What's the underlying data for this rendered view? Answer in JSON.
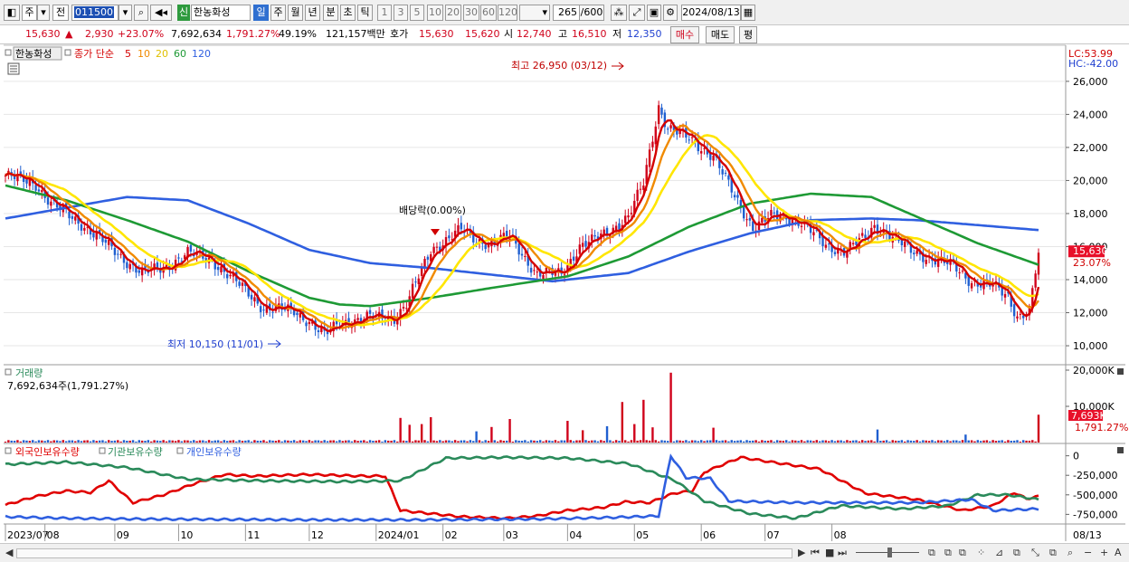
{
  "toolbar": {
    "market_labels": [
      "주",
      "전"
    ],
    "stock_code": "011500",
    "tag_new": "신",
    "stock_name": "한농화성",
    "periods": [
      "일",
      "주",
      "월",
      "년",
      "분",
      "초",
      "틱"
    ],
    "active_period": "일",
    "intervals": [
      "1",
      "3",
      "5",
      "10",
      "20",
      "30",
      "60",
      "120"
    ],
    "count": "265",
    "count_max": "/600",
    "date": "2024/08/13"
  },
  "quote": {
    "price": "15,630",
    "change_arrow": "▲",
    "change": "2,930",
    "change_pct": "+23.07%",
    "volume": "7,692,634",
    "volume_ratio": "1,791.27%",
    "rate": "49.19%",
    "amount": "121,157백만",
    "bid_ask_label": "호가",
    "ask": "15,630",
    "bid": "15,620",
    "open_label": "시",
    "open": "12,740",
    "high_label": "고",
    "high": "16,510",
    "low_label": "저",
    "low": "12,350",
    "buy_label": "매수",
    "sell_label": "매도",
    "avg_label": "평"
  },
  "colors": {
    "up": "#d0021b",
    "down": "#1f5fd0",
    "ma5": "#d40000",
    "ma10": "#f08a00",
    "ma20": "#ffe600",
    "ma60": "#1e9a35",
    "ma120": "#2f5fe0",
    "foreign": "#e00000",
    "institution": "#2a8a5a",
    "individual": "#2f5fe0"
  },
  "chart_data": [
    {
      "type": "candlestick",
      "title": "한농화성",
      "legend": {
        "prefix": "종가 단순",
        "periods": [
          "5",
          "10",
          "20",
          "60",
          "120"
        ]
      },
      "corner_labels": [
        "LC:53.99",
        "HC:-42.00"
      ],
      "y_ticks": [
        "26,000",
        "24,000",
        "22,000",
        "20,000",
        "18,000",
        "16,000",
        "14,000",
        "12,000",
        "10,000"
      ],
      "ylim": [
        9400,
        27800
      ],
      "last_price_label": "15,630",
      "last_change_label": "23.07%",
      "annotations": {
        "high": "최고 26,950 (03/12)",
        "low": "최저 10,150 (11/01)",
        "dividend": "배당락(0.00%)"
      },
      "x_labels": [
        "2023/07",
        "08",
        "09",
        "10",
        "11",
        "12",
        "2024/01",
        "02",
        "03",
        "04",
        "05",
        "06",
        "07",
        "08"
      ],
      "x_end_label": "08/13",
      "close_path": [
        [
          0,
          20300
        ],
        [
          10,
          19800
        ],
        [
          15,
          18600
        ],
        [
          25,
          17400
        ],
        [
          38,
          15400
        ],
        [
          45,
          14400
        ],
        [
          52,
          14700
        ],
        [
          60,
          15600
        ],
        [
          68,
          15200
        ],
        [
          78,
          13500
        ],
        [
          85,
          12300
        ],
        [
          95,
          12100
        ],
        [
          100,
          11500
        ],
        [
          105,
          10600
        ],
        [
          110,
          11400
        ],
        [
          120,
          11700
        ],
        [
          128,
          11700
        ],
        [
          132,
          12500
        ],
        [
          140,
          15800
        ],
        [
          150,
          17000
        ],
        [
          155,
          16400
        ],
        [
          160,
          16200
        ],
        [
          166,
          16600
        ],
        [
          170,
          15600
        ],
        [
          175,
          14300
        ],
        [
          183,
          14400
        ],
        [
          189,
          16000
        ],
        [
          193,
          16300
        ],
        [
          199,
          17000
        ],
        [
          205,
          17800
        ],
        [
          210,
          19800
        ],
        [
          215,
          24500
        ],
        [
          218,
          23200
        ],
        [
          225,
          22500
        ],
        [
          233,
          21500
        ],
        [
          240,
          19000
        ],
        [
          246,
          17200
        ],
        [
          252,
          17800
        ],
        [
          257,
          17800
        ],
        [
          262,
          17500
        ],
        [
          270,
          16000
        ],
        [
          276,
          15800
        ],
        [
          283,
          16500
        ],
        [
          286,
          17200
        ],
        [
          290,
          16900
        ],
        [
          298,
          15700
        ],
        [
          305,
          15300
        ],
        [
          312,
          14800
        ],
        [
          318,
          13900
        ],
        [
          325,
          13600
        ],
        [
          330,
          13000
        ],
        [
          333,
          11800
        ],
        [
          337,
          12100
        ],
        [
          340,
          15630
        ]
      ],
      "ma60_path": [
        [
          0,
          19700
        ],
        [
          20,
          18800
        ],
        [
          40,
          17600
        ],
        [
          60,
          16300
        ],
        [
          80,
          14500
        ],
        [
          100,
          12900
        ],
        [
          110,
          12500
        ],
        [
          120,
          12400
        ],
        [
          140,
          12900
        ],
        [
          160,
          13500
        ],
        [
          185,
          14200
        ],
        [
          205,
          15400
        ],
        [
          225,
          17200
        ],
        [
          245,
          18600
        ],
        [
          265,
          19200
        ],
        [
          285,
          19000
        ],
        [
          300,
          17800
        ],
        [
          320,
          16200
        ],
        [
          340,
          14900
        ]
      ],
      "ma120_path": [
        [
          0,
          17700
        ],
        [
          40,
          19000
        ],
        [
          60,
          18800
        ],
        [
          80,
          17400
        ],
        [
          100,
          15800
        ],
        [
          120,
          15000
        ],
        [
          140,
          14700
        ],
        [
          160,
          14300
        ],
        [
          180,
          13900
        ],
        [
          205,
          14400
        ],
        [
          225,
          15700
        ],
        [
          245,
          16800
        ],
        [
          265,
          17600
        ],
        [
          285,
          17700
        ],
        [
          300,
          17600
        ],
        [
          320,
          17300
        ],
        [
          340,
          17000
        ]
      ]
    },
    {
      "type": "bar",
      "title": "거래량",
      "value_label": "7,692,634주(1,791.27%)",
      "y_ticks": [
        "20,000K",
        "10,000K"
      ],
      "ylim": [
        0,
        20000
      ],
      "last_label": "7,693K",
      "last_ratio": "1,791.27%",
      "spikes": [
        [
          130,
          6800
        ],
        [
          133,
          4900
        ],
        [
          137,
          5100
        ],
        [
          140,
          7000
        ],
        [
          155,
          3100
        ],
        [
          160,
          4300
        ],
        [
          166,
          6500
        ],
        [
          185,
          6000
        ],
        [
          190,
          3400
        ],
        [
          198,
          4500
        ],
        [
          203,
          11200
        ],
        [
          207,
          5100
        ],
        [
          210,
          11800
        ],
        [
          213,
          4200
        ],
        [
          219,
          19300
        ],
        [
          233,
          4100
        ],
        [
          287,
          3600
        ],
        [
          316,
          2200
        ],
        [
          340,
          7693
        ]
      ]
    },
    {
      "type": "line",
      "legend": [
        "외국인보유수량",
        "기관보유수량",
        "개인보유수량"
      ],
      "y_ticks": [
        "0",
        "-250,000",
        "-500,000",
        "-750,000"
      ],
      "ylim": [
        -850000,
        100000
      ],
      "series": [
        {
          "name": "외국인보유수량",
          "points": [
            [
              0,
              -630000
            ],
            [
              10,
              -520000
            ],
            [
              20,
              -450000
            ],
            [
              28,
              -470000
            ],
            [
              34,
              -320000
            ],
            [
              42,
              -600000
            ],
            [
              52,
              -500000
            ],
            [
              62,
              -360000
            ],
            [
              72,
              -240000
            ],
            [
              82,
              -260000
            ],
            [
              100,
              -240000
            ],
            [
              118,
              -260000
            ],
            [
              125,
              -260000
            ],
            [
              130,
              -700000
            ],
            [
              150,
              -780000
            ],
            [
              165,
              -800000
            ],
            [
              175,
              -770000
            ],
            [
              185,
              -700000
            ],
            [
              197,
              -660000
            ],
            [
              204,
              -590000
            ],
            [
              212,
              -600000
            ],
            [
              220,
              -480000
            ],
            [
              226,
              -450000
            ],
            [
              230,
              -210000
            ],
            [
              242,
              -20000
            ],
            [
              252,
              -80000
            ],
            [
              268,
              -170000
            ],
            [
              283,
              -480000
            ],
            [
              300,
              -560000
            ],
            [
              315,
              -700000
            ],
            [
              325,
              -640000
            ],
            [
              332,
              -470000
            ],
            [
              336,
              -550000
            ],
            [
              340,
              -520000
            ]
          ]
        },
        {
          "name": "기관보유수량",
          "points": [
            [
              0,
              -110000
            ],
            [
              20,
              -80000
            ],
            [
              40,
              -150000
            ],
            [
              60,
              -300000
            ],
            [
              85,
              -320000
            ],
            [
              110,
              -330000
            ],
            [
              130,
              -320000
            ],
            [
              145,
              -30000
            ],
            [
              165,
              -20000
            ],
            [
              185,
              -30000
            ],
            [
              205,
              -100000
            ],
            [
              220,
              -310000
            ],
            [
              230,
              -580000
            ],
            [
              245,
              -740000
            ],
            [
              260,
              -800000
            ],
            [
              275,
              -640000
            ],
            [
              295,
              -680000
            ],
            [
              310,
              -640000
            ],
            [
              320,
              -500000
            ],
            [
              330,
              -500000
            ],
            [
              340,
              -560000
            ]
          ]
        },
        {
          "name": "개인보유수량",
          "points": [
            [
              0,
              -780000
            ],
            [
              20,
              -800000
            ],
            [
              45,
              -810000
            ],
            [
              100,
              -820000
            ],
            [
              140,
              -820000
            ],
            [
              175,
              -810000
            ],
            [
              200,
              -790000
            ],
            [
              215,
              -770000
            ],
            [
              219,
              0
            ],
            [
              224,
              -280000
            ],
            [
              232,
              -290000
            ],
            [
              238,
              -580000
            ],
            [
              260,
              -600000
            ],
            [
              300,
              -600000
            ],
            [
              318,
              -560000
            ],
            [
              325,
              -700000
            ],
            [
              340,
              -680000
            ]
          ]
        }
      ]
    }
  ],
  "statusbar": {
    "nav_icons": [
      "scroll-right",
      "first",
      "prev",
      "stop",
      "next"
    ],
    "tool_icons": [
      "zoom",
      "minus",
      "plus"
    ]
  }
}
